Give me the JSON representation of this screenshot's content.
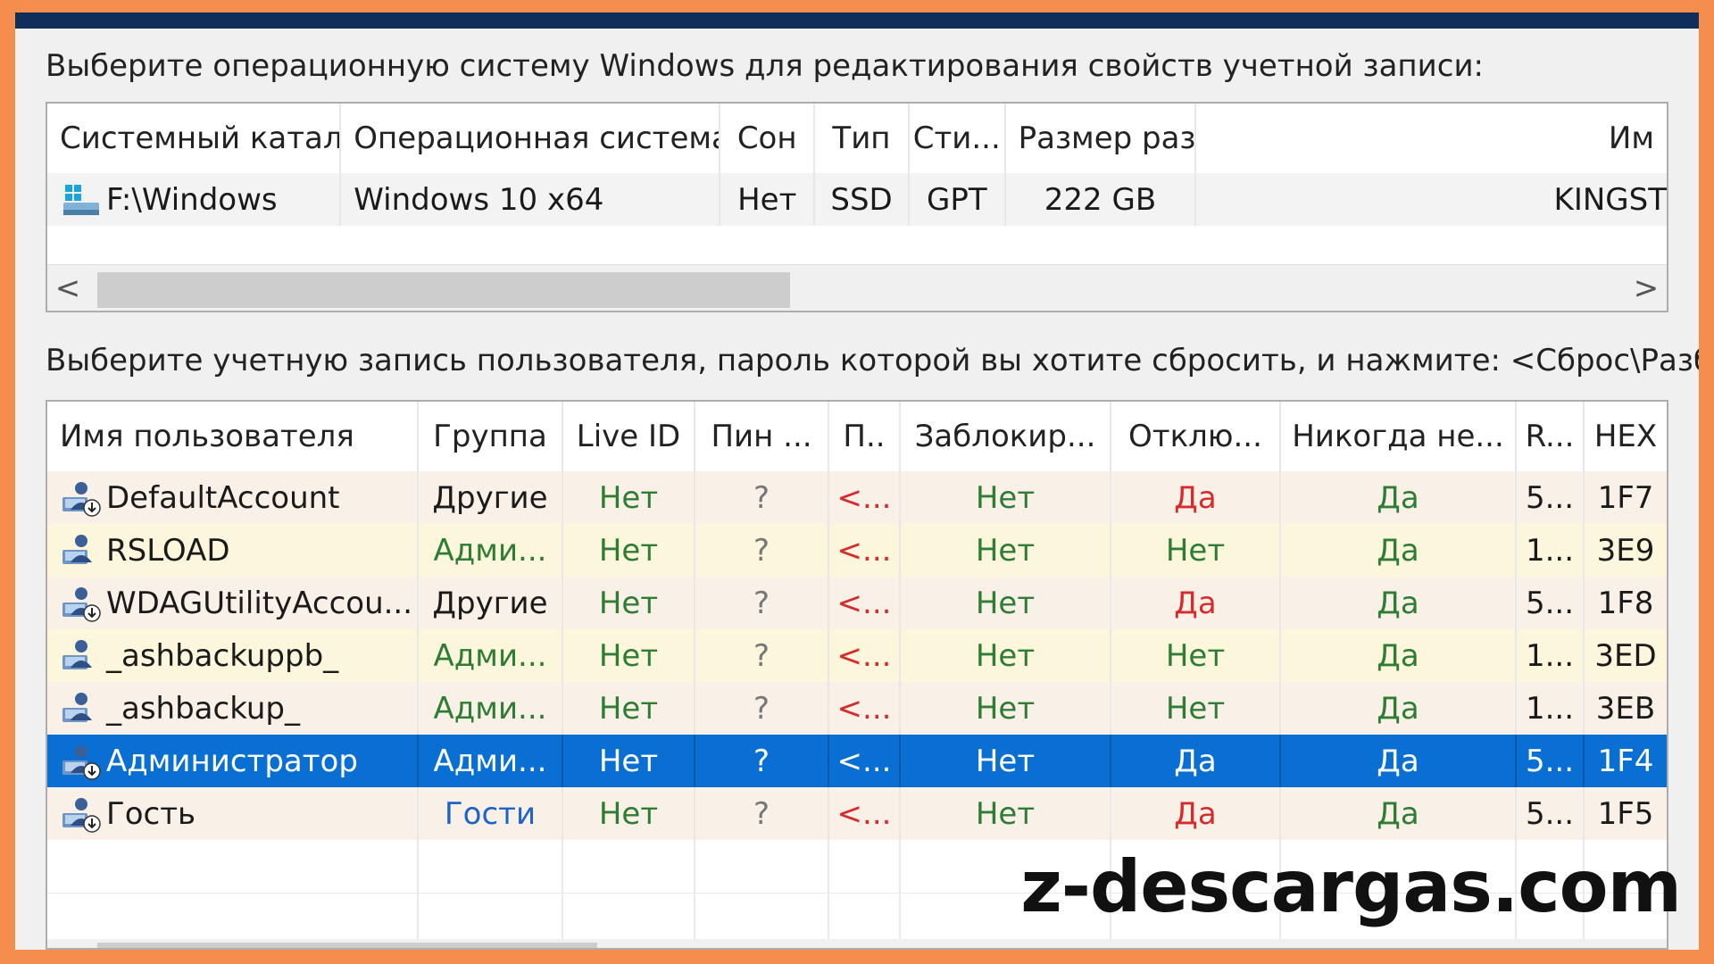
{
  "captions": {
    "os_prompt": "Выберите операционную систему Windows для редактирования свойств учетной записи:",
    "user_prompt": "Выберите учетную запись пользователя, пароль которой вы хотите сбросить, и нажмите: <Сброс\\Разбл>"
  },
  "os_table": {
    "headers": [
      "Системный каталог",
      "Операционная система",
      "Сон",
      "Тип",
      "Сти...",
      "Размер раз...",
      "Им"
    ],
    "rows": [
      {
        "dir": "F:\\Windows",
        "os": "Windows 10 x64",
        "sleep": "Нет",
        "type": "SSD",
        "style": "GPT",
        "size": "222 GB",
        "name": "KINGST"
      }
    ],
    "scroll": {
      "left_arrow": "<",
      "right_arrow": ">"
    }
  },
  "user_table": {
    "headers": [
      "Имя пользователя",
      "Группа",
      "Live ID",
      "Пин ...",
      "П..",
      "Заблокир...",
      "Отклю...",
      "Никогда не...",
      "R...",
      "HEX"
    ],
    "rows": [
      {
        "user": "DefaultAccount",
        "group": "Другие",
        "live": "Нет",
        "pin": "?",
        "p": "<...",
        "locked": "Нет",
        "disabled": "Да",
        "never": "Да",
        "r": "5...",
        "hex": "1F7",
        "group_color": "default",
        "disabled_color": "red",
        "icon": "user-disabled-icon"
      },
      {
        "user": "RSLOAD",
        "group": "Адми...",
        "live": "Нет",
        "pin": "?",
        "p": "<...",
        "locked": "Нет",
        "disabled": "Нет",
        "never": "Да",
        "r": "1...",
        "hex": "3E9",
        "group_color": "green",
        "disabled_color": "green",
        "icon": "user-admin-icon"
      },
      {
        "user": "WDAGUtilityAccou...",
        "group": "Другие",
        "live": "Нет",
        "pin": "?",
        "p": "<...",
        "locked": "Нет",
        "disabled": "Да",
        "never": "Да",
        "r": "5...",
        "hex": "1F8",
        "group_color": "default",
        "disabled_color": "red",
        "icon": "user-disabled-icon"
      },
      {
        "user": "_ashbackuppb_",
        "group": "Адми...",
        "live": "Нет",
        "pin": "?",
        "p": "<...",
        "locked": "Нет",
        "disabled": "Нет",
        "never": "Да",
        "r": "1...",
        "hex": "3ED",
        "group_color": "green",
        "disabled_color": "green",
        "icon": "user-admin-icon"
      },
      {
        "user": "_ashbackup_",
        "group": "Адми...",
        "live": "Нет",
        "pin": "?",
        "p": "<...",
        "locked": "Нет",
        "disabled": "Нет",
        "never": "Да",
        "r": "1...",
        "hex": "3EB",
        "group_color": "green",
        "disabled_color": "green",
        "icon": "user-admin-icon"
      },
      {
        "user": "Администратор",
        "group": "Адми...",
        "live": "Нет",
        "pin": "?",
        "p": "<...",
        "locked": "Нет",
        "disabled": "Да",
        "never": "Да",
        "r": "5...",
        "hex": "1F4",
        "group_color": "green",
        "disabled_color": "red",
        "icon": "user-disabled-icon",
        "selected": true
      },
      {
        "user": "Гость",
        "group": "Гости",
        "live": "Нет",
        "pin": "?",
        "p": "<...",
        "locked": "Нет",
        "disabled": "Да",
        "never": "Да",
        "r": "5...",
        "hex": "1F5",
        "group_color": "blue",
        "disabled_color": "red",
        "icon": "user-disabled-icon"
      }
    ]
  },
  "watermark": "z-descargas.com",
  "colors": {
    "border_accent": "#f58d4c",
    "selection": "#0a6fd2",
    "green": "#2e7d32",
    "red": "#d62b2b",
    "blue": "#1e63c8",
    "row_odd": "#f9f1e8",
    "row_even": "#fbf6dc"
  }
}
